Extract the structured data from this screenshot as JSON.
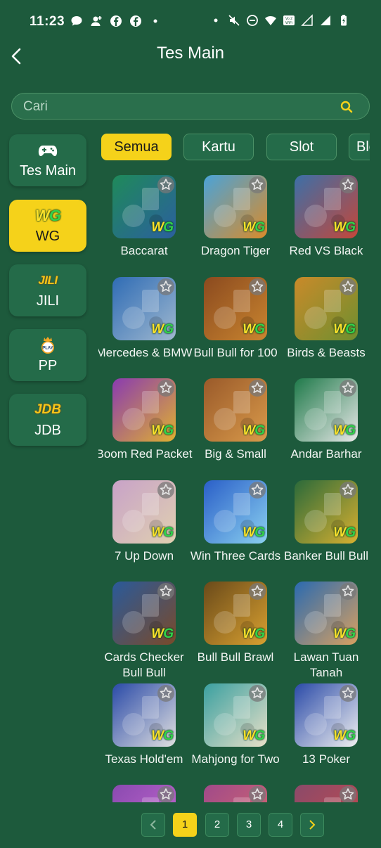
{
  "status_bar": {
    "time": "11:23",
    "wifi_badge": "Vo 2\nWiFi"
  },
  "header": {
    "title": "Tes Main"
  },
  "search": {
    "placeholder": "Cari",
    "value": ""
  },
  "providers": [
    {
      "label": "Tes Main",
      "icon": "gamepad-icon",
      "active": false
    },
    {
      "label": "WG",
      "logo": "WG",
      "active": true
    },
    {
      "label": "JILI",
      "logo": "JILI",
      "active": false
    },
    {
      "label": "PP",
      "logo": "PLAY",
      "active": false
    },
    {
      "label": "JDB",
      "logo": "JDB",
      "active": false
    }
  ],
  "tabs": [
    {
      "label": "Semua",
      "active": true
    },
    {
      "label": "Kartu",
      "active": false
    },
    {
      "label": "Slot",
      "active": false
    },
    {
      "label": "Blo",
      "active": false
    }
  ],
  "games": [
    {
      "name": "Baccarat",
      "colors": [
        "#1f8a5a",
        "#2b5f9e"
      ]
    },
    {
      "name": "Dragon Tiger",
      "colors": [
        "#4aa3d8",
        "#d98b2a"
      ]
    },
    {
      "name": "Red VS Black",
      "colors": [
        "#3c6fa8",
        "#c3473a"
      ]
    },
    {
      "name": "Mercedes & BMW",
      "colors": [
        "#2f6cb5",
        "#9fb8cf"
      ]
    },
    {
      "name": "Bull Bull for 100",
      "colors": [
        "#8b4a1f",
        "#c9852f"
      ]
    },
    {
      "name": "Birds & Beasts",
      "colors": [
        "#c98a2a",
        "#6e8f2f"
      ]
    },
    {
      "name": "Boom Red Packet",
      "colors": [
        "#8a3bb0",
        "#e0b030"
      ]
    },
    {
      "name": "Big & Small",
      "colors": [
        "#9a5a2a",
        "#d99a4a"
      ]
    },
    {
      "name": "Andar Barhar",
      "colors": [
        "#1f7a4a",
        "#e8e8e8"
      ]
    },
    {
      "name": "7 Up Down",
      "colors": [
        "#c8a2c8",
        "#e0d0b0"
      ]
    },
    {
      "name": "Win Three Cards",
      "colors": [
        "#2a5fc8",
        "#8ad0f0"
      ]
    },
    {
      "name": "Banker Bull Bull",
      "colors": [
        "#2b6a3a",
        "#d8b030"
      ]
    },
    {
      "name": "Cards Checker Bull Bull",
      "colors": [
        "#2a5a9a",
        "#7a4a2a"
      ]
    },
    {
      "name": "Bull Bull Brawl",
      "colors": [
        "#6a4a1a",
        "#d8a030"
      ]
    },
    {
      "name": "Lawan Tuan Tanah",
      "colors": [
        "#2a6ab0",
        "#d8a060"
      ]
    },
    {
      "name": "Texas Hold'em",
      "colors": [
        "#2a4aa8",
        "#e0e0e0"
      ]
    },
    {
      "name": "Mahjong for Two",
      "colors": [
        "#3aa0a0",
        "#e8e0c8"
      ]
    },
    {
      "name": "13 Poker",
      "colors": [
        "#2a4aa8",
        "#f0f0f0"
      ]
    },
    {
      "name": "",
      "colors": [
        "#8a4ab0",
        "#c86ad0"
      ]
    },
    {
      "name": "",
      "colors": [
        "#a04a8a",
        "#d86a6a"
      ]
    },
    {
      "name": "",
      "colors": [
        "#8a4a6a",
        "#c84a4a"
      ]
    }
  ],
  "pagination": {
    "pages": [
      "1",
      "2",
      "3",
      "4"
    ],
    "current": "1"
  },
  "colors": {
    "background": "#1d5a3c",
    "accent": "#f5d21a",
    "card": "#246b49"
  }
}
